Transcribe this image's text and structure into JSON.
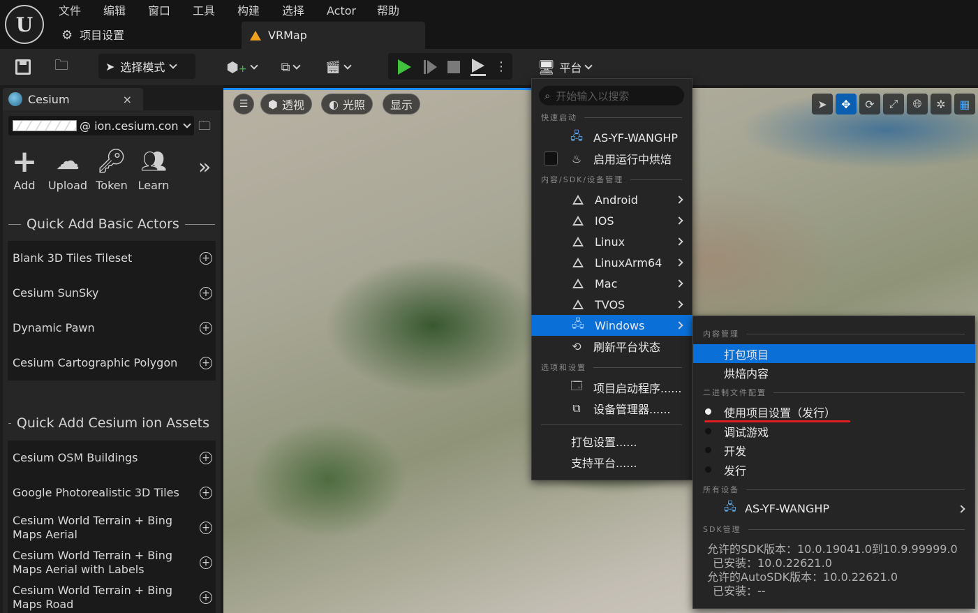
{
  "menubar": {
    "items": [
      "文件",
      "编辑",
      "窗口",
      "工具",
      "构建",
      "选择",
      "Actor",
      "帮助"
    ],
    "project_settings": "项目设置"
  },
  "tab": {
    "map_name": "VRMap"
  },
  "toolbar": {
    "mode_label": "选择模式",
    "platform_label": "平台"
  },
  "cesium_panel": {
    "tab_label": "Cesium",
    "close": "×",
    "account": "@ ion.cesium.con",
    "tools": [
      {
        "label": "Add",
        "icon": "plus-icon"
      },
      {
        "label": "Upload",
        "icon": "cloud-upload-icon"
      },
      {
        "label": "Token",
        "icon": "key-icon"
      },
      {
        "label": "Learn",
        "icon": "learn-icon"
      }
    ],
    "more": "»",
    "basic_header": "Quick Add Basic Actors",
    "basic_items": [
      "Blank 3D Tiles Tileset",
      "Cesium SunSky",
      "Dynamic Pawn",
      "Cesium Cartographic Polygon"
    ],
    "ion_header": "Quick Add Cesium ion Assets",
    "ion_items": [
      "Cesium OSM Buildings",
      "Google Photorealistic 3D Tiles",
      "Cesium World Terrain + Bing Maps Aerial",
      "Cesium World Terrain + Bing Maps Aerial with Labels",
      "Cesium World Terrain + Bing Maps Road"
    ]
  },
  "viewport": {
    "perspective": "透视",
    "lighting": "光照",
    "show": "显示"
  },
  "platform_menu": {
    "search_placeholder": "开始输入以搜索",
    "quick_launch_header": "快速启动",
    "device": "AS-YF-WANGHP",
    "cook_on_fly": "启用运行中烘焙",
    "sdk_header": "内容/SDK/设备管理",
    "platforms": [
      "Android",
      "IOS",
      "Linux",
      "LinuxArm64",
      "Mac",
      "TVOS"
    ],
    "windows": "Windows",
    "refresh": "刷新平台状态",
    "options_header": "选项和设置",
    "launcher": "项目启动程序......",
    "device_manager": "设备管理器......",
    "packaging_settings": "打包设置......",
    "supported_platforms": "支持平台......"
  },
  "windows_menu": {
    "content_header": "内容管理",
    "package_project": "打包项目",
    "cook_content": "烘焙内容",
    "binary_header": "二进制文件配置",
    "build_configs": [
      "使用项目设置（发行）",
      "调试游戏",
      "开发",
      "发行"
    ],
    "all_devices_header": "所有设备",
    "device": "AS-YF-WANGHP",
    "sdk_mgmt_header": "SDK管理",
    "sdk_lines": [
      "允许的SDK版本：10.0.19041.0到10.9.99999.0",
      "已安装：10.0.22621.0",
      "允许的AutoSDK版本：10.0.22621.0",
      "已安装：--"
    ]
  },
  "colors": {
    "accent": "#1a8cff",
    "highlight": "#0a70d8",
    "play_green": "#44c040",
    "underline_red": "#e02020"
  }
}
